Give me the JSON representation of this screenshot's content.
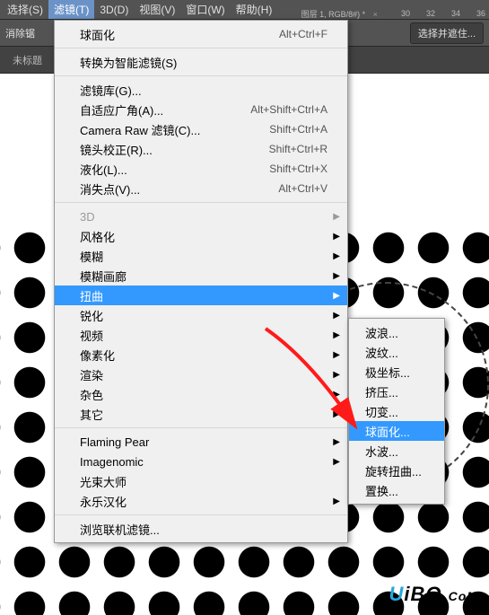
{
  "menubar": {
    "items": [
      "选择(S)",
      "滤镜(T)",
      "3D(D)",
      "视图(V)",
      "窗口(W)",
      "帮助(H)"
    ],
    "selected_index": 1
  },
  "toolbar": {
    "tool_label": "消除锯",
    "mask_button": "选择并遮住..."
  },
  "tabbar": {
    "tab1": "未标题",
    "tab2": "图层 1, RGB/8#) *",
    "ruler_marks": [
      "30",
      "32",
      "34",
      "36"
    ]
  },
  "dropdown": {
    "group0": [
      {
        "label": "球面化",
        "shortcut": "Alt+Ctrl+F"
      }
    ],
    "group1": [
      {
        "label": "转换为智能滤镜(S)"
      }
    ],
    "group2": [
      {
        "label": "滤镜库(G)..."
      },
      {
        "label": "自适应广角(A)...",
        "shortcut": "Alt+Shift+Ctrl+A"
      },
      {
        "label": "Camera Raw 滤镜(C)...",
        "shortcut": "Shift+Ctrl+A"
      },
      {
        "label": "镜头校正(R)...",
        "shortcut": "Shift+Ctrl+R"
      },
      {
        "label": "液化(L)...",
        "shortcut": "Shift+Ctrl+X"
      },
      {
        "label": "消失点(V)...",
        "shortcut": "Alt+Ctrl+V"
      }
    ],
    "group3": [
      {
        "label": "3D",
        "arrow": true,
        "disabled": true
      },
      {
        "label": "风格化",
        "arrow": true
      },
      {
        "label": "模糊",
        "arrow": true
      },
      {
        "label": "模糊画廊",
        "arrow": true
      },
      {
        "label": "扭曲",
        "arrow": true,
        "highlight": true
      },
      {
        "label": "锐化",
        "arrow": true
      },
      {
        "label": "视频",
        "arrow": true
      },
      {
        "label": "像素化",
        "arrow": true
      },
      {
        "label": "渲染",
        "arrow": true
      },
      {
        "label": "杂色",
        "arrow": true
      },
      {
        "label": "其它",
        "arrow": true
      }
    ],
    "group4": [
      {
        "label": "Flaming Pear",
        "arrow": true
      },
      {
        "label": "Imagenomic",
        "arrow": true
      },
      {
        "label": "光束大师"
      },
      {
        "label": "永乐汉化",
        "arrow": true
      }
    ],
    "group5": [
      {
        "label": "浏览联机滤镜..."
      }
    ]
  },
  "submenu": {
    "items": [
      "波浪...",
      "波纹...",
      "极坐标...",
      "挤压...",
      "切变...",
      "球面化...",
      "水波...",
      "旋转扭曲...",
      "置换..."
    ],
    "highlight_index": 5
  },
  "watermark": {
    "u": "U",
    "i": "i",
    "bq": "BQ.",
    "c": "C",
    "o": "o",
    "m": "M"
  }
}
